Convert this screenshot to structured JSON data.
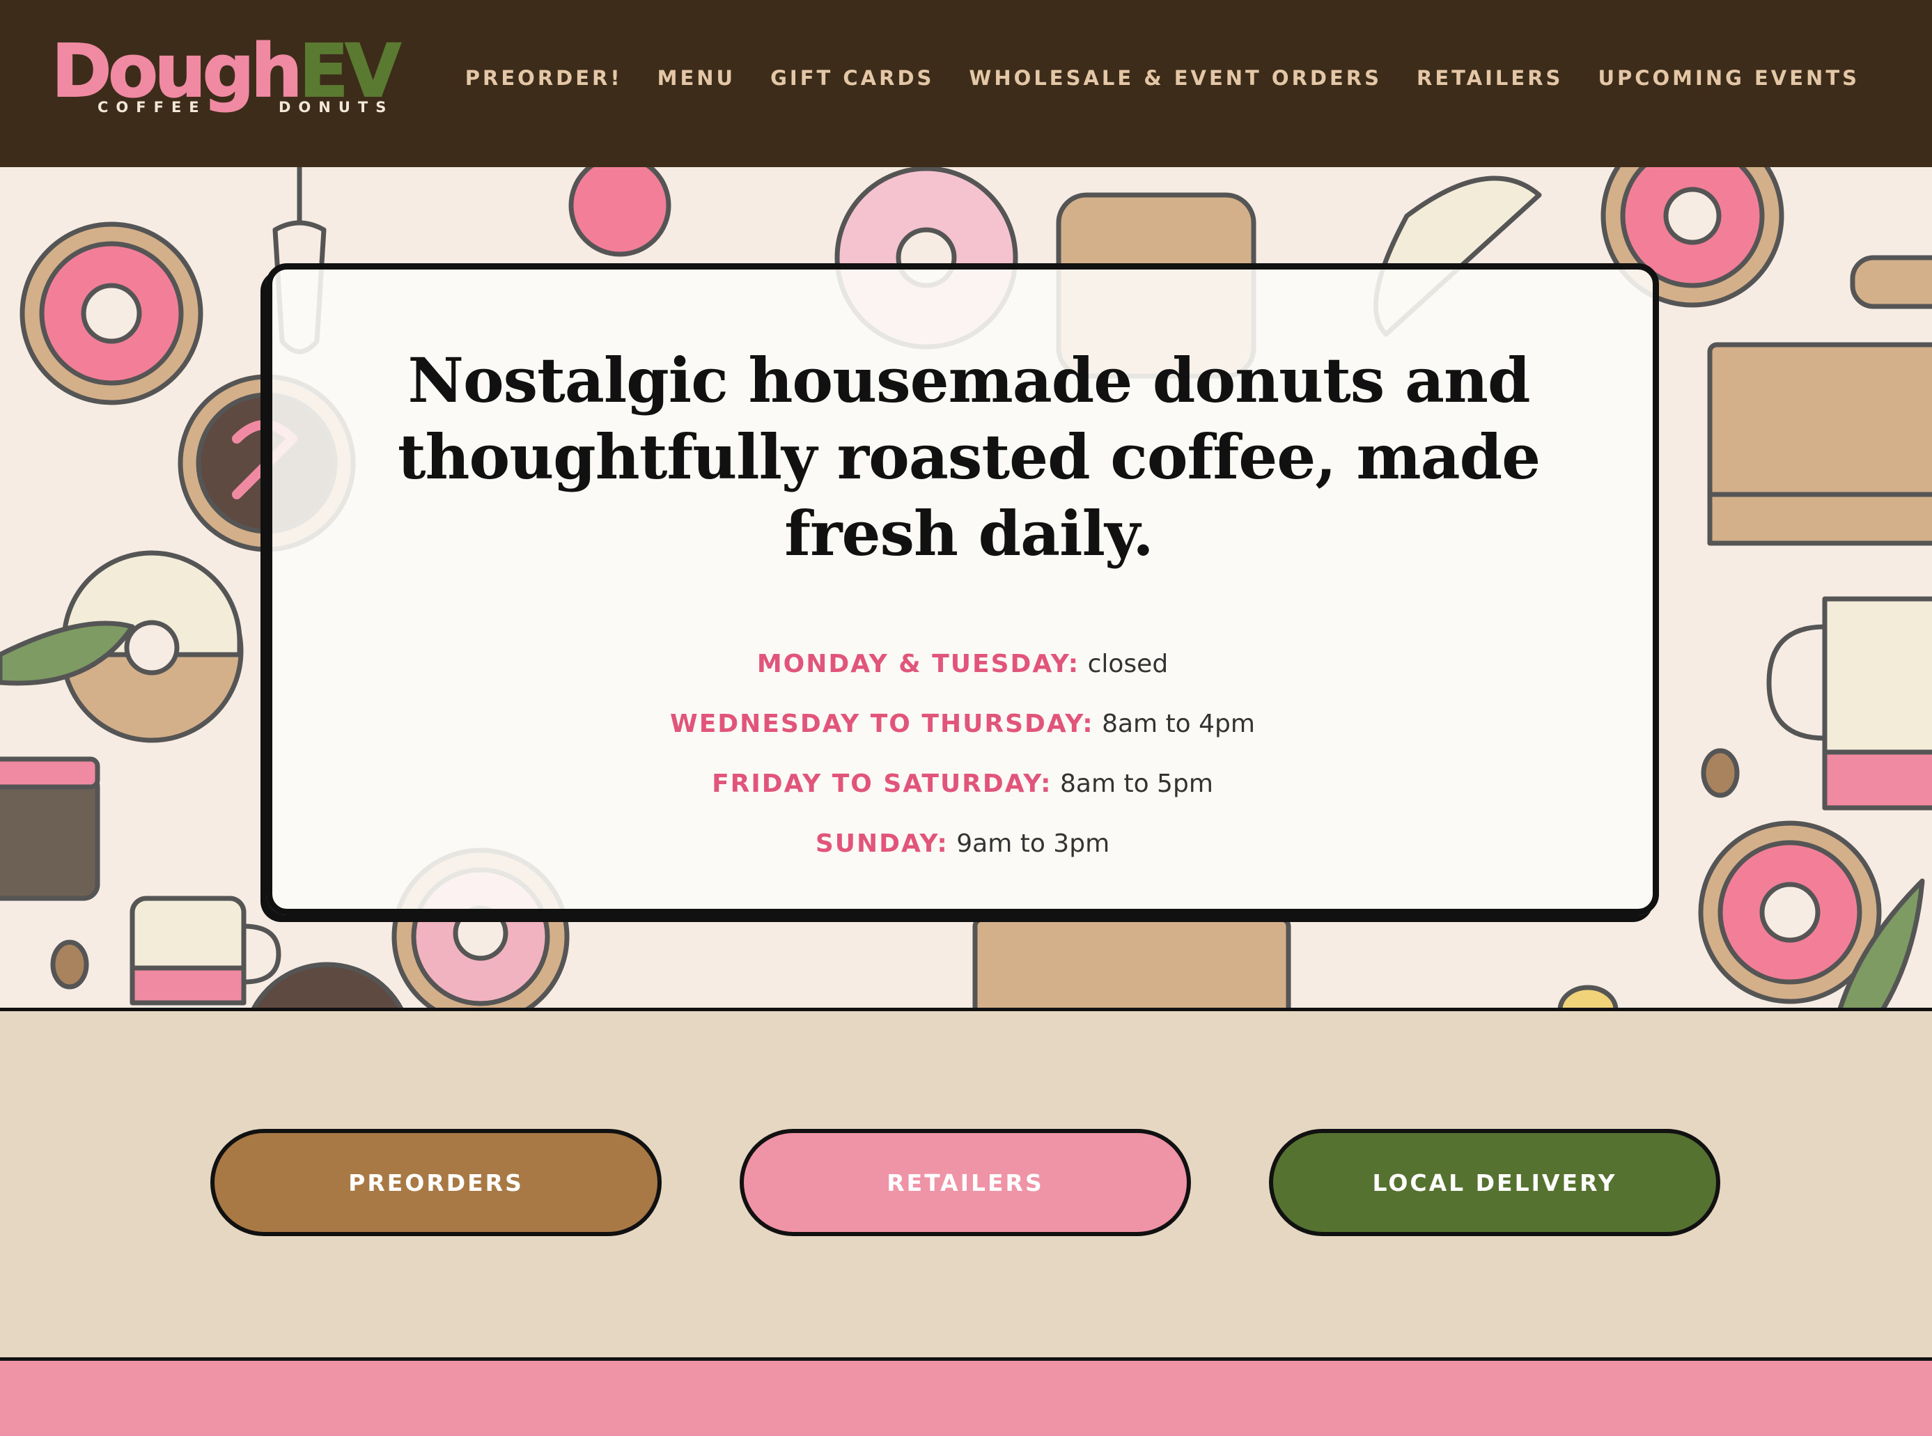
{
  "brand": {
    "name_part1": "Dough",
    "name_part2": "EV",
    "tagline_left": "COFFEE",
    "tagline_right": "DONUTS",
    "colors": {
      "pink": "#f08aa3",
      "green": "#5a7a31",
      "header_bg": "#3d2c1a",
      "nav_text": "#e3c7a6"
    }
  },
  "nav": {
    "items": [
      {
        "label": "PREORDER!"
      },
      {
        "label": "MENU"
      },
      {
        "label": "GIFT CARDS"
      },
      {
        "label": "WHOLESALE & EVENT ORDERS"
      },
      {
        "label": "RETAILERS"
      },
      {
        "label": "UPCOMING EVENTS"
      }
    ]
  },
  "hero": {
    "title": "Nostalgic housemade donuts and thoughtfully roasted coffee, made fresh daily.",
    "hours": [
      {
        "day": "MONDAY & TUESDAY:",
        "time": "closed"
      },
      {
        "day": "WEDNESDAY TO THURSDAY:",
        "time": "8am to 4pm"
      },
      {
        "day": "FRIDAY TO SATURDAY:",
        "time": "8am to 5pm"
      },
      {
        "day": "SUNDAY:",
        "time": "9am to 3pm"
      }
    ],
    "background_pattern": "donut-coffee-doodle-pattern"
  },
  "cta": {
    "preorders": {
      "label": "PREORDERS",
      "color": "#a87845"
    },
    "retailers": {
      "label": "RETAILERS",
      "color": "#ef94a6"
    },
    "delivery": {
      "label": "LOCAL DELIVERY",
      "color": "#557230"
    }
  }
}
